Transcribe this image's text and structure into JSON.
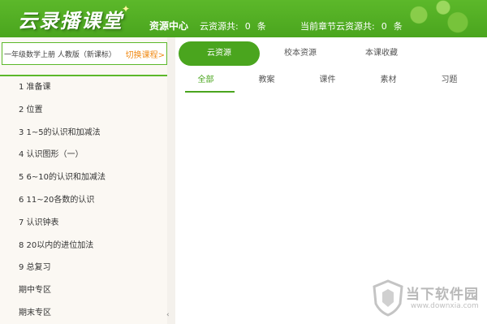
{
  "header": {
    "logo": "云录播课堂",
    "resource_center": "资源中心",
    "cloud_label": "云资源共:",
    "cloud_count": "0",
    "cloud_unit": "条",
    "chapter_label": "当前章节云资源共:",
    "chapter_count": "0",
    "chapter_unit": "条",
    "color": "#4aa51e"
  },
  "sidebar": {
    "book_name": "一年级数学上册 人教版（新课标）",
    "switch_label": "切换课程>",
    "items": [
      "1 准备课",
      "2 位置",
      "3 1~5的认识和加减法",
      "4 认识图形（一）",
      "5 6~10的认识和加减法",
      "6 11~20各数的认识",
      "7 认识钟表",
      "8 20以内的进位加法",
      "9 总复习",
      "期中专区",
      "期末专区"
    ]
  },
  "main": {
    "tabs": [
      "云资源",
      "校本资源",
      "本课收藏"
    ],
    "active_tab": "云资源",
    "filters": [
      "全部",
      "教案",
      "课件",
      "素材",
      "习题"
    ],
    "active_filter": "全部"
  },
  "watermark": {
    "title": "当下软件园",
    "url": "www.downxia.com"
  }
}
